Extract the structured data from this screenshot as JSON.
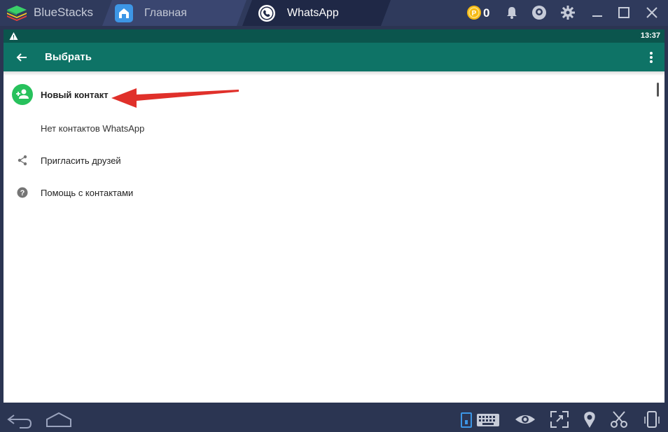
{
  "window": {
    "app_name": "BlueStacks",
    "tabs": [
      {
        "label": "Главная",
        "icon": "home-icon"
      },
      {
        "label": "WhatsApp",
        "icon": "whatsapp-icon"
      }
    ],
    "coins": "0",
    "toolbar_icons": [
      "coin-icon",
      "bell-icon",
      "account-icon",
      "gear-icon",
      "minimize-icon",
      "maximize-icon",
      "close-icon"
    ]
  },
  "android": {
    "status_time": "13:37",
    "toolbar_title": "Выбрать",
    "items": [
      {
        "label": "Новый контакт",
        "icon": "add-contact-icon"
      },
      {
        "label": "Нет контактов WhatsApp"
      },
      {
        "label": "Пригласить друзей",
        "icon": "share-icon"
      },
      {
        "label": "Помощь с контактами",
        "icon": "help-icon"
      }
    ]
  },
  "bottom_icons": [
    "back-icon",
    "home-icon",
    "portrait-icon",
    "keyboard-icon",
    "eye-icon",
    "fullscreen-icon",
    "location-icon",
    "scissors-icon",
    "phone-rotate-icon"
  ],
  "colors": {
    "whatsapp_header": "#0e7366",
    "whatsapp_status": "#0b554d",
    "avatar_green": "#27c15c",
    "annotation_red": "#e0302a",
    "chrome_bg": "#2f3a5c"
  }
}
